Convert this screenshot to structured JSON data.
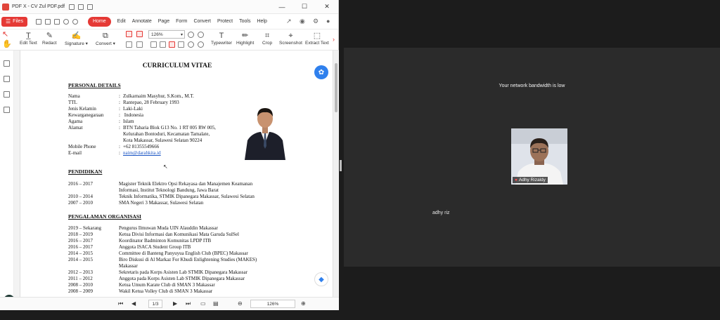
{
  "window": {
    "title": "PDF X - CV Zul PDF.pdf",
    "minimize": "—",
    "maximize": "☐",
    "close": "✕"
  },
  "menubar": {
    "files_label": "Files",
    "tabs": [
      "Home",
      "Edit",
      "Annotate",
      "Page",
      "Form",
      "Convert",
      "Protect",
      "Tools",
      "Help"
    ],
    "active_tab": "Home"
  },
  "toolbar": {
    "edit_text": "Edit Text",
    "redact": "Redact",
    "signature": "Signature ▾",
    "convert": "Convert ▾",
    "zoom_value": "126%",
    "typewriter": "Typewriter",
    "highlight": "Highlight",
    "crop": "Crop",
    "screenshot": "Screenshot",
    "extract_text": "Extract Text"
  },
  "cv": {
    "title": "CURRICULUM VITAE",
    "personal": {
      "heading": "PERSONAL DETAILS",
      "rows": [
        {
          "k": "Nama",
          "v": "Zulkarnaim Masyhur, S.Kom., M.T."
        },
        {
          "k": "TTL",
          "v": "Rantepao, 28 February 1993"
        },
        {
          "k": "Jenis Kelamin",
          "v": "Laki-Laki"
        },
        {
          "k": "Kewarganegaraan",
          "v": " Indonesia"
        },
        {
          "k": "Agama",
          "v": "Islam"
        },
        {
          "k": "Alamat",
          "v": "BTN Tabaria Blok G13 No. 1 RT 005 RW 005,"
        }
      ],
      "address_cont_1": "Kelurahan Bontoduri, Kecamatan Tamalate,",
      "address_cont_2": "Kota Makassar, Sulawesi Selatan 90224",
      "mobile_k": "Mobile Phone",
      "mobile_v": "+62 81355549666",
      "email_k": "E-mail",
      "email_v": "naim@darahkita.id"
    },
    "pendidikan": {
      "heading": "PENDIDIKAN",
      "rows": [
        {
          "y": "2016 – 2017",
          "v": "Magister Teknik Elektro Opsi Rekayasa dan Manajemen Keamanan"
        },
        {
          "y": "",
          "v": "Informasi, Institut Teknologi Bandung, Jawa Barat"
        },
        {
          "y": "2010 – 2014",
          "v": "Teknik Informatika, STMIK Dipanegara Makassar, Sulawesi Selatan"
        },
        {
          "y": "2007 – 2010",
          "v": "SMA Negeri 3 Makassar, Sulawesi Selatan"
        }
      ]
    },
    "organisasi": {
      "heading": "PENGALAMAN ORGANISASI",
      "rows": [
        {
          "y": "2019 – Sekarang",
          "v": "Pengurus Ilmuwan Muda UIN Alauddin Makassar"
        },
        {
          "y": "2018 – 2019",
          "v": "Ketua Divisi Informasi dan Komunikasi Mata Garuda SulSel"
        },
        {
          "y": "2016 – 2017",
          "v": "Koordinator Badminton Komunitas LPDP ITB"
        },
        {
          "y": "2016 – 2017",
          "v": "Anggota ISACA Student Group ITB"
        },
        {
          "y": "2014 – 2015",
          "v": "Committee di Banteng Panyuyua English Club (BPEC) Makassar"
        },
        {
          "y": "2014 – 2015",
          "v": "Biro Diskusi di Al Markaz For Khudi Enlightening Studies (MAKES)"
        },
        {
          "y": "",
          "v": "Makassar"
        },
        {
          "y": "2012 – 2013",
          "v": "Sekretaris pada Korps Asisten Lab STMIK Dipanegara Makassar"
        },
        {
          "y": "2011 – 2012",
          "v": "Anggota pada Korps Asisten Lab STMIK Dipanegara Makassar"
        },
        {
          "y": "2008 – 2010",
          "v": "Ketua Umum Karate Club di SMAN 3 Makassar"
        },
        {
          "y": "2008 – 2009",
          "v": "Wakil Ketua Volley Club di SMAN 3 Makassar"
        }
      ]
    }
  },
  "statusbar": {
    "page": "1/3",
    "zoom": "126%"
  },
  "meeting": {
    "network_message": "Your network bandwidth is low",
    "tile_name": "Adhy Rizaldy",
    "participant_label": "adhy riz"
  },
  "colors": {
    "accent": "#e53935",
    "meeting_bg": "#2b2b2b",
    "desktop_bg": "#1c1c1c"
  }
}
